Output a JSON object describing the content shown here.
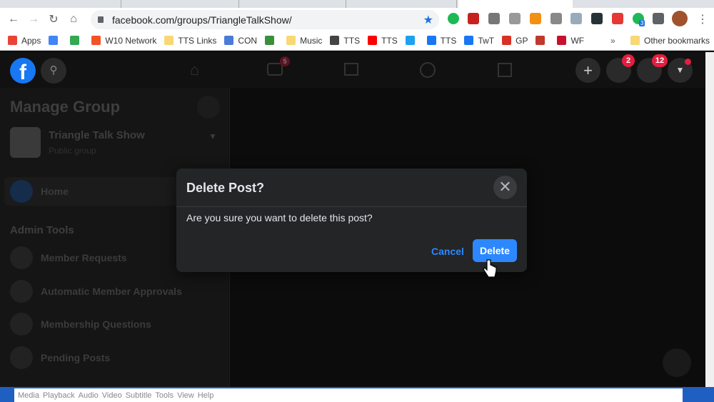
{
  "browser": {
    "url": "facebook.com/groups/TriangleTalkShow/",
    "bookmarks": [
      {
        "label": "Apps",
        "color": "#ea4335"
      },
      {
        "label": "",
        "color": "#4285f4"
      },
      {
        "label": "",
        "color": "#34a853"
      },
      {
        "label": "W10 Network",
        "color": "#f35325"
      },
      {
        "label": "TTS Links",
        "color": "#f8d775"
      },
      {
        "label": "CON",
        "color": "#4a7bd8"
      },
      {
        "label": "",
        "color": "#3a8f3a"
      },
      {
        "label": "Music",
        "color": "#f8d775"
      },
      {
        "label": "TTS",
        "color": "#444"
      },
      {
        "label": "TTS",
        "color": "#ff0000"
      },
      {
        "label": "",
        "color": "#1da1f2"
      },
      {
        "label": "TTS",
        "color": "#1877f2"
      },
      {
        "label": "TwT",
        "color": "#1877f2"
      },
      {
        "label": "GP",
        "color": "#d93025"
      },
      {
        "label": "",
        "color": "#c0392b"
      },
      {
        "label": "WF",
        "color": "#c8102e"
      }
    ],
    "overflow": "»",
    "other_bookmarks": "Other bookmarks",
    "extension_badge": "3"
  },
  "facebook": {
    "video_badge": "5",
    "messenger_badge": "2",
    "notifications_badge": "12",
    "sidebar": {
      "title": "Manage Group",
      "group_name": "Triangle Talk Show",
      "group_type": "Public group",
      "home": "Home",
      "admin_tools": "Admin Tools",
      "items": [
        "Member Requests",
        "Automatic Member Approvals",
        "Membership Questions",
        "Pending Posts"
      ]
    }
  },
  "dialog": {
    "title": "Delete Post?",
    "message": "Are you sure you want to delete this post?",
    "cancel": "Cancel",
    "delete": "Delete",
    "primary_color": "#2d88ff"
  },
  "vlc": {
    "menu": [
      "Media",
      "Playback",
      "Audio",
      "Video",
      "Subtitle",
      "Tools",
      "View",
      "Help"
    ]
  }
}
